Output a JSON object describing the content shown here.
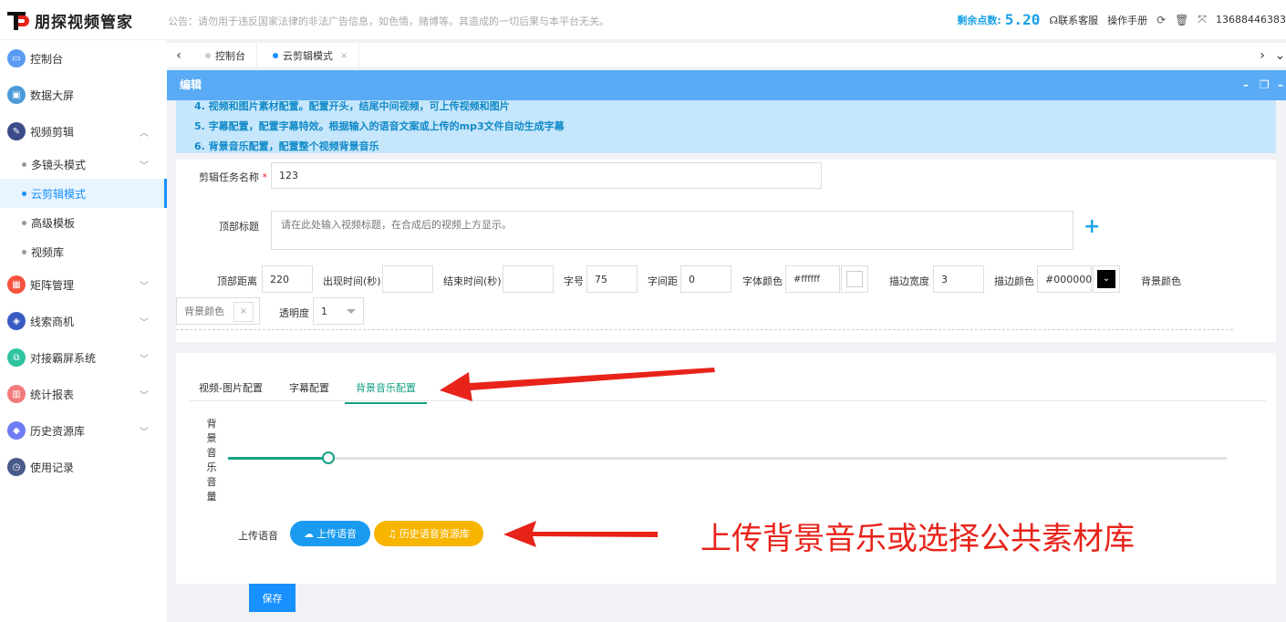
{
  "header": {
    "brand": "朋探视频管家",
    "notice": "公告：请勿用于违反国家法律的非法广告信息，如色情，赌博等。其造成的一切后果与本平台无关。",
    "points_label": "剩余点数:",
    "points_value": "5.20",
    "support": "联系客服",
    "manual": "操作手册",
    "phone": "13688446383"
  },
  "sidebar": {
    "items": [
      {
        "label": "控制台",
        "icon": "monitor-icon",
        "color": "#5b9cf2"
      },
      {
        "label": "数据大屏",
        "icon": "screen-icon",
        "color": "#4a9bd8"
      },
      {
        "label": "视频剪辑",
        "icon": "edit-icon",
        "color": "#3a4c8a"
      },
      {
        "label": "矩阵管理",
        "icon": "matrix-icon",
        "color": "#f5533d"
      },
      {
        "label": "线索商机",
        "icon": "leads-icon",
        "color": "#3a5bc4"
      },
      {
        "label": "对接霸屏系统",
        "icon": "dock-icon",
        "color": "#2ec4a0"
      },
      {
        "label": "统计报表",
        "icon": "chart-icon",
        "color": "#f27a7a"
      },
      {
        "label": "历史资源库",
        "icon": "cube-icon",
        "color": "#6e7cf5"
      },
      {
        "label": "使用记录",
        "icon": "clock-icon",
        "color": "#4a5a8a"
      }
    ],
    "sub_items": [
      "多镜头模式",
      "云剪辑模式",
      "高级模板",
      "视频库"
    ]
  },
  "tabs": {
    "items": [
      {
        "label": "控制台"
      },
      {
        "label": "云剪辑模式"
      }
    ]
  },
  "modal": {
    "title": "编辑",
    "info_lines": [
      "4. 视频和图片素材配置。配置开头，结尾中间视频，可上传视频和图片",
      "5. 字幕配置，配置字幕特效。根据输入的语音文案或上传的mp3文件自动生成字幕",
      "6. 背景音乐配置，配置整个视频背景音乐"
    ]
  },
  "form": {
    "task_name_label": "剪辑任务名称",
    "task_name_value": "123",
    "top_title_label": "顶部标题",
    "top_title_placeholder": "请在此处输入视频标题，在合成后的视频上方显示。",
    "top_distance_label": "顶部距离",
    "top_distance_value": "220",
    "show_time_label": "出现时间(秒)",
    "show_time_value": "",
    "end_time_label": "结束时间(秒)",
    "end_time_value": "",
    "font_size_label": "字号",
    "font_size_value": "75",
    "letter_spacing_label": "字间距",
    "letter_spacing_value": "0",
    "font_color_label": "字体颜色",
    "font_color_value": "#ffffff",
    "stroke_width_label": "描边宽度",
    "stroke_width_value": "3",
    "stroke_color_label": "描边颜色",
    "stroke_color_value": "#000000",
    "bg_color_label": "背景颜色",
    "bg_color_placeholder": "背景颜色",
    "opacity_label": "透明度",
    "opacity_value": "1"
  },
  "config_tabs": {
    "items": [
      "视频-图片配置",
      "字幕配置",
      "背景音乐配置"
    ],
    "active": "背景音乐配置"
  },
  "music": {
    "volume_label": [
      "背",
      "景",
      "音",
      "乐",
      "音",
      "量"
    ],
    "volume_fraction": 0.1,
    "upload_label": "上传语音",
    "upload_button": "上传语音",
    "history_button": "历史语音资源库"
  },
  "save_button": "保存",
  "annotation": "上传背景音乐或选择公共素材库",
  "colors": {
    "accent": "#1890ff",
    "green": "#16a085",
    "annotation_red": "#e8231a",
    "upload_blue": "#1a9bf0",
    "history_orange": "#f7b500"
  }
}
